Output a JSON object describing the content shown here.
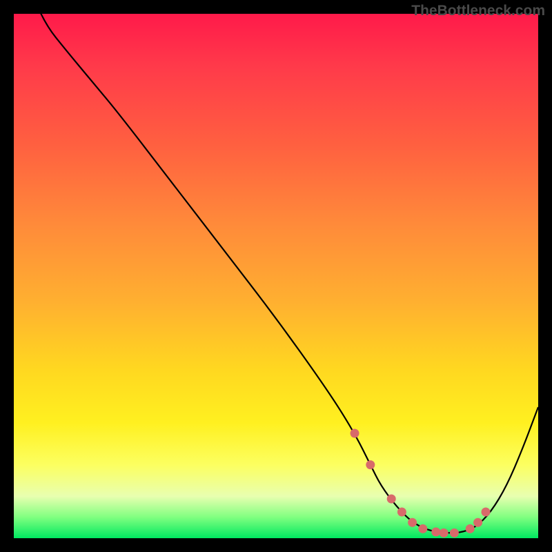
{
  "watermark": "TheBottleneck.com",
  "chart_data": {
    "type": "line",
    "title": "",
    "xlabel": "",
    "ylabel": "",
    "xlim": [
      0,
      100
    ],
    "ylim": [
      0,
      100
    ],
    "series": [
      {
        "name": "curve",
        "x": [
          0,
          3,
          6,
          10,
          15,
          20,
          30,
          40,
          50,
          60,
          65,
          68,
          70,
          73,
          76,
          79,
          82,
          85,
          88,
          91,
          94,
          97,
          100
        ],
        "y": [
          118,
          105,
          98,
          93,
          87,
          81,
          68,
          55,
          42,
          28,
          20,
          14,
          10,
          6,
          3,
          1.5,
          1,
          1,
          2,
          5,
          10,
          17,
          25
        ]
      }
    ],
    "highlight_points": {
      "x": [
        65,
        68,
        72,
        74,
        76,
        78,
        80.5,
        82,
        84,
        87,
        88.5,
        90
      ],
      "y": [
        20,
        14,
        7.5,
        5,
        3,
        1.8,
        1.2,
        1,
        1,
        1.8,
        3,
        5
      ]
    },
    "gradient_stops": [
      {
        "pos": 0,
        "color": "#ff1a4a"
      },
      {
        "pos": 25,
        "color": "#ff6040"
      },
      {
        "pos": 55,
        "color": "#ffb030"
      },
      {
        "pos": 78,
        "color": "#fff020"
      },
      {
        "pos": 96,
        "color": "#80ff80"
      },
      {
        "pos": 100,
        "color": "#00e860"
      }
    ]
  }
}
